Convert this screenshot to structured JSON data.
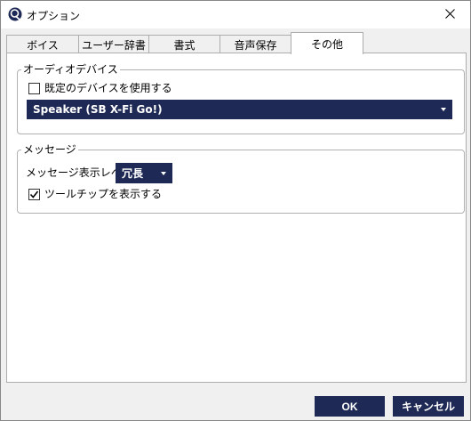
{
  "window": {
    "title": "オプション",
    "app_icon": "app-logo-icon",
    "close_icon": "close-icon"
  },
  "tabs": [
    {
      "label": "ボイス",
      "active": false
    },
    {
      "label": "ユーザー辞書",
      "active": false
    },
    {
      "label": "書式",
      "active": false
    },
    {
      "label": "音声保存",
      "active": false
    },
    {
      "label": "その他",
      "active": true
    }
  ],
  "audio_device": {
    "group_title": "オーディオデバイス",
    "use_default_label": "既定のデバイスを使用する",
    "use_default_checked": false,
    "device_selected": "Speaker (SB X-Fi Go!)"
  },
  "message": {
    "group_title": "メッセージ",
    "level_label": "メッセージ表示レベル",
    "level_selected": "冗長",
    "tooltip_label": "ツールチップを表示する",
    "tooltip_checked": true
  },
  "buttons": {
    "ok_label": "OK",
    "cancel_label": "キャンセル"
  },
  "colors": {
    "accent": "#1e2a55",
    "panel_background": "#ffffff",
    "window_background": "#f0f0f0"
  }
}
